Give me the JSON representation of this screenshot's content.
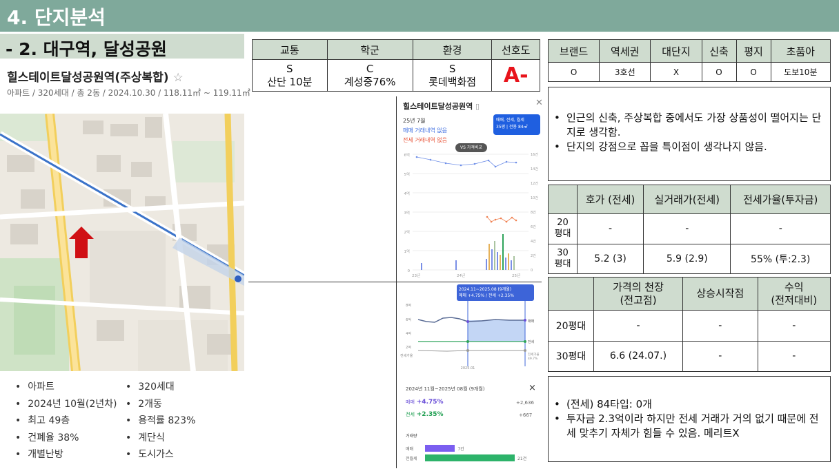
{
  "header": {
    "title": "4. 단지분석",
    "subtitle": "- 2. 대구역, 달성공원"
  },
  "complex": {
    "name": "힐스테이트달성공원역(주상복합)",
    "star": "☆",
    "meta": "아파트 / 320세대 / 총 2동 / 2024.10.30 / 118.11㎡ ~ 119.11㎡"
  },
  "info_left": [
    "아파트",
    "2024년 10월(2년차)",
    "최고 49층",
    "건폐율 38%",
    "개별난방"
  ],
  "info_right": [
    "320세대",
    "2개동",
    "용적률 823%",
    "계단식",
    "도시가스"
  ],
  "grade_table": {
    "headers": [
      "교통",
      "학군",
      "환경",
      "선호도"
    ],
    "cells": [
      [
        "S",
        "산단 10분"
      ],
      [
        "C",
        "계성중76%"
      ],
      [
        "S",
        "롯데백화점"
      ]
    ],
    "preference": "A-"
  },
  "attr_table": {
    "headers": [
      "브랜드",
      "역세권",
      "대단지",
      "신축",
      "평지",
      "초품아"
    ],
    "values": [
      "O",
      "3호선",
      "X",
      "O",
      "O",
      "도보10분"
    ]
  },
  "notes_top": [
    "인근의 신축, 주상복합 중에서도 가장 상품성이 떨어지는 단지로 생각함.",
    "단지의 강점으로 꼽을 특이점이 생각나지 않음."
  ],
  "price_table": {
    "headers": [
      "호가 (전세)",
      "실거래가(전세)",
      "전세가율(투자금)"
    ],
    "rows": [
      {
        "label": "20\n평대",
        "values": [
          "-",
          "-",
          "-"
        ]
      },
      {
        "label": "30\n평대",
        "values": [
          "5.2 (3)",
          "5.9 (2.9)",
          "55% (투:2.3)"
        ]
      }
    ]
  },
  "ceiling_table": {
    "headers": [
      "가격의 천장\n(전고점)",
      "상승시작점",
      "수익\n(전저대비)"
    ],
    "rows": [
      {
        "label": "20평대",
        "values": [
          "-",
          "-",
          "-"
        ]
      },
      {
        "label": "30평대",
        "values": [
          "6.6 (24.07.)",
          "-",
          "-"
        ]
      }
    ]
  },
  "notes_bottom": [
    "(전세) 84타입: 0개",
    "투자금 2.3억이라 하지만 전세 거래가 거의 없기 때문에 전세 맞추기 자체가 힘들 수 있음. 메리트X"
  ],
  "shot1": {
    "title": "힐스테이트달성공원역",
    "title_icon": "book-icon",
    "month": "25년 7월",
    "sale_none": "매매 거래내역 없음",
    "jeonse_none": "전세 거래내역 없음",
    "filter_line1": "매매, 전세, 월세",
    "filter_line2": "35평 | 전용 84㎡",
    "vs_button": "VS 가격비교",
    "left_ticks": [
      "6억",
      "5억",
      "4억",
      "3억",
      "2억",
      "1억",
      "0"
    ],
    "right_ticks": [
      "16건",
      "14건",
      "12건",
      "10건",
      "8건",
      "6건",
      "4건",
      "2건",
      "0"
    ],
    "x_ticks": [
      "23년",
      "24년",
      "25년"
    ],
    "colors": {
      "sale": "#6f8fe8",
      "jeonse": "#f08050"
    }
  },
  "shot2": {
    "tooltip_line1": "2024.11~2025.08 (9개월)",
    "tooltip_line2": "매매 +4.75% / 전세 +2.35%",
    "y_ticks": [
      "8억",
      "6억",
      "4억",
      "2억"
    ],
    "row_label": "전세가율",
    "right_sale": "매매",
    "right_jeonse": "전세",
    "right_rate": "전세가율\n49.7%",
    "x_tick": "2025.01"
  },
  "shot3": {
    "period": "2024년 11월~2025년 08월 (9개월)",
    "close": "×",
    "sale_label": "매매",
    "sale_pct": "+4.75%",
    "sale_amt": "+2,636",
    "jeonse_label": "전세",
    "jeonse_pct": "+2.35%",
    "jeonse_amt": "+667",
    "volume_title": "거래량",
    "bar_sale_label": "매매",
    "bar_sale_val": "7건",
    "bar_jeonse_label": "전월세",
    "bar_jeonse_val": "21건",
    "sale_count": 7,
    "jeonse_count": 21
  }
}
